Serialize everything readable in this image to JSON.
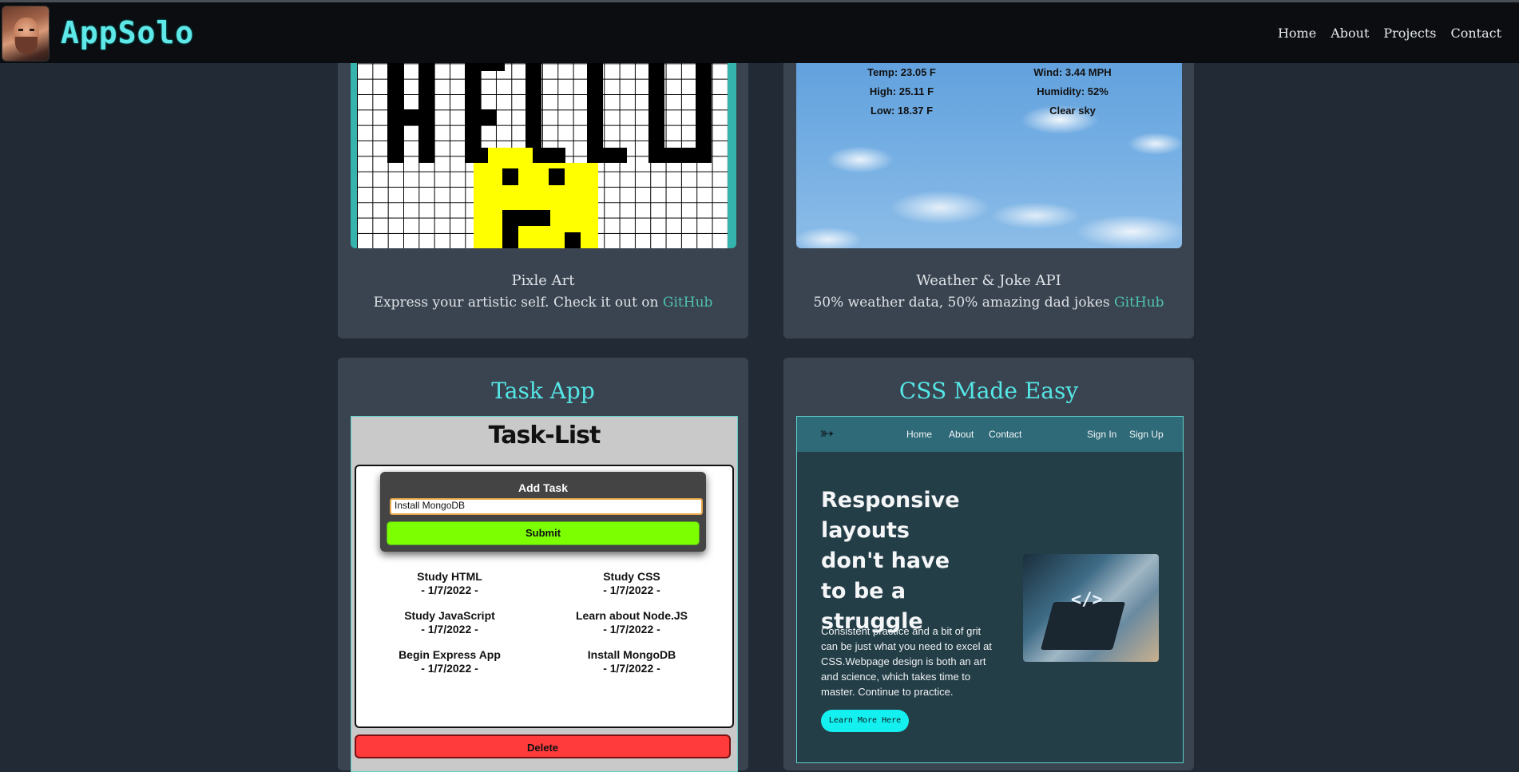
{
  "header": {
    "brand": "AppSolo",
    "nav": [
      "Home",
      "About",
      "Projects",
      "Contact"
    ]
  },
  "projects": [
    {
      "name": "Pixle Art",
      "description": "Express your artistic self. Check it out on ",
      "link": "GitHub",
      "art_word": "HELLO"
    },
    {
      "name": "Weather & Joke API",
      "description": "50% weather data, 50% amazing dad jokes ",
      "link": "GitHub",
      "weather": {
        "temp": "Temp: 23.05 F",
        "high": "High: 25.11 F",
        "low": "Low: 18.37 F",
        "wind": "Wind: 3.44 MPH",
        "humidity": "Humidity: 52%",
        "sky": "Clear sky"
      }
    },
    {
      "name": "Task App",
      "app": {
        "title": "Task-List",
        "form_title": "Add Task",
        "input_value": "Install MongoDB",
        "submit_label": "Submit",
        "delete_label": "Delete",
        "tasks": [
          {
            "name": "Study HTML",
            "date": "- 1/7/2022 -"
          },
          {
            "name": "Study CSS",
            "date": "- 1/7/2022 -"
          },
          {
            "name": "Study JavaScript",
            "date": "- 1/7/2022 -"
          },
          {
            "name": "Learn about Node.JS",
            "date": "- 1/7/2022 -"
          },
          {
            "name": "Begin Express App",
            "date": "- 1/7/2022 -"
          },
          {
            "name": "Install MongoDB",
            "date": "- 1/7/2022 -"
          }
        ]
      }
    },
    {
      "name": "CSS Made Easy",
      "site": {
        "nav": [
          "Home",
          "About",
          "Contact"
        ],
        "auth": [
          "Sign In",
          "Sign Up"
        ],
        "hero": "Responsive layouts don't have to be a struggle",
        "body": "Consistent practice and a bit of grit can be just what you need to excel at CSS.Webpage design is both an art and science, which takes time to master. Continue to practice.",
        "button": "Learn More Here"
      }
    }
  ],
  "colors": {
    "page_bg": "#222b35",
    "card_bg": "#3a4450",
    "accent": "#55e6e6",
    "link": "#4fc3b1",
    "submit_green": "#7cff00",
    "delete_red": "#ff3b3b"
  }
}
